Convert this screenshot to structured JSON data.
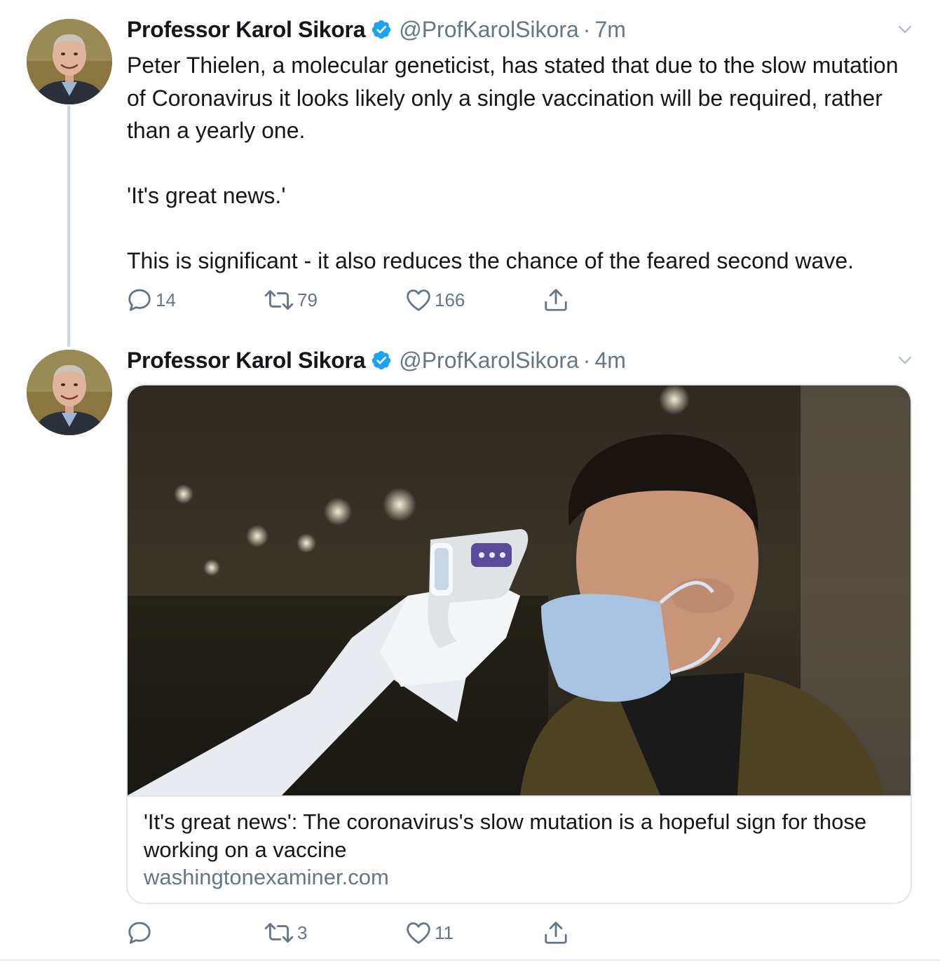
{
  "colors": {
    "text": "#14171a",
    "secondary": "#657786",
    "verified": "#1da1f2",
    "border": "#e1e8ed",
    "thread_line": "#ccd6dd"
  },
  "tweets": [
    {
      "author_name": "Professor Karol Sikora",
      "handle": "@ProfKarolSikora",
      "separator": "·",
      "time": "7m",
      "text": "Peter Thielen, a molecular geneticist, has stated that due to the slow mutation of Coronavirus it looks likely only a single vaccination will be required, rather than a yearly one.\n\n'It's great news.'\n\nThis is significant - it also reduces the chance of the feared second wave.",
      "actions": {
        "replies": "14",
        "retweets": "79",
        "likes": "166"
      },
      "icons": {
        "verified": "verified-badge-icon",
        "caret": "chevron-down-icon",
        "reply": "reply-icon",
        "retweet": "retweet-icon",
        "like": "heart-icon",
        "share": "share-icon"
      }
    },
    {
      "author_name": "Professor Karol Sikora",
      "handle": "@ProfKarolSikora",
      "separator": "·",
      "time": "4m",
      "card": {
        "title": "'It's great news': The coronavirus's slow mutation is a hopeful sign for those working on a vaccine",
        "domain": "washingtonexaminer.com"
      },
      "actions": {
        "replies": "",
        "retweets": "3",
        "likes": "11"
      },
      "icons": {
        "verified": "verified-badge-icon",
        "caret": "chevron-down-icon",
        "reply": "reply-icon",
        "retweet": "retweet-icon",
        "like": "heart-icon",
        "share": "share-icon"
      }
    }
  ]
}
